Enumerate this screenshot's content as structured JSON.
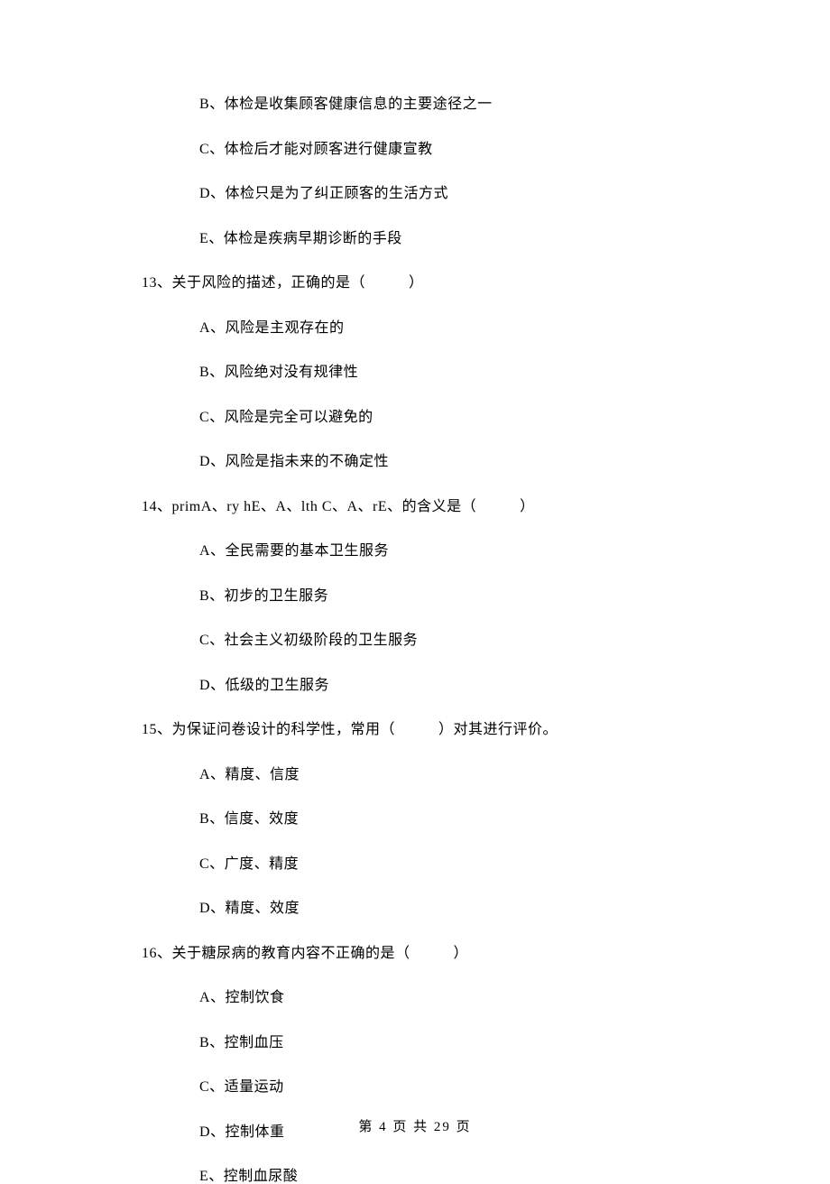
{
  "options_prefix": [
    "B、体检是收集顾客健康信息的主要途径之一",
    "C、体检后才能对顾客进行健康宣教",
    "D、体检只是为了纠正顾客的生活方式",
    "E、体检是疾病早期诊断的手段"
  ],
  "q13": {
    "stem_pre": "13、关于风险的描述，正确的是（",
    "stem_post": "）",
    "options": [
      "A、风险是主观存在的",
      "B、风险绝对没有规律性",
      "C、风险是完全可以避免的",
      "D、风险是指未来的不确定性"
    ]
  },
  "q14": {
    "stem_pre": "14、primA、ry hE、A、lth C、A、rE、的含义是（",
    "stem_post": "）",
    "options": [
      "A、全民需要的基本卫生服务",
      "B、初步的卫生服务",
      "C、社会主义初级阶段的卫生服务",
      "D、低级的卫生服务"
    ]
  },
  "q15": {
    "stem_pre": "15、为保证问卷设计的科学性，常用（",
    "stem_post": "）对其进行评价。",
    "options": [
      "A、精度、信度",
      "B、信度、效度",
      "C、广度、精度",
      "D、精度、效度"
    ]
  },
  "q16": {
    "stem_pre": "16、关于糖尿病的教育内容不正确的是（",
    "stem_post": "）",
    "options": [
      "A、控制饮食",
      "B、控制血压",
      "C、适量运动",
      "D、控制体重",
      "E、控制血尿酸"
    ]
  },
  "footer": "第 4 页 共 29 页"
}
